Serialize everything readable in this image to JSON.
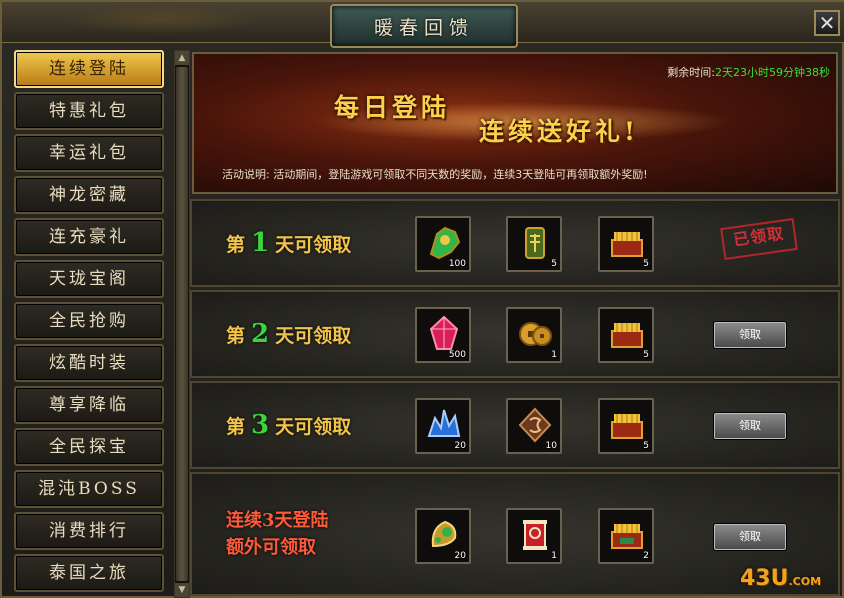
{
  "window": {
    "title": "暖春回馈",
    "close_label": "✕"
  },
  "sidebar": {
    "items": [
      {
        "label": "连续登陆",
        "active": true
      },
      {
        "label": "特惠礼包"
      },
      {
        "label": "幸运礼包"
      },
      {
        "label": "神龙密藏"
      },
      {
        "label": "连充豪礼"
      },
      {
        "label": "天珑宝阁"
      },
      {
        "label": "全民抢购"
      },
      {
        "label": "炫酷时装"
      },
      {
        "label": "尊享降临"
      },
      {
        "label": "全民探宝"
      },
      {
        "label": "混沌BOSS"
      },
      {
        "label": "消费排行"
      },
      {
        "label": "泰国之旅"
      }
    ]
  },
  "banner": {
    "countdown_label": "剩余时间:",
    "countdown_value": "2天23小时59分钟38秒",
    "slogan_line1": "每日登陆",
    "slogan_line2": "连续送好礼!",
    "description": "活动说明: 活动期间，登陆游戏可领取不同天数的奖励，连续3天登陆可再领取额外奖励!"
  },
  "rows": [
    {
      "prefix": "第",
      "day": "1",
      "suffix": "天可领取",
      "status": "已领取",
      "items": [
        {
          "icon": "green-jade-icon",
          "count": "100"
        },
        {
          "icon": "talisman-icon",
          "count": "5"
        },
        {
          "icon": "gold-chest-icon",
          "count": "5"
        }
      ]
    },
    {
      "prefix": "第",
      "day": "2",
      "suffix": "天可领取",
      "button": "领取",
      "items": [
        {
          "icon": "red-crystal-icon",
          "count": "500"
        },
        {
          "icon": "copper-coin-icon",
          "count": "1"
        },
        {
          "icon": "gold-chest-icon",
          "count": "5"
        }
      ]
    },
    {
      "prefix": "第",
      "day": "3",
      "suffix": "天可领取",
      "button": "领取",
      "items": [
        {
          "icon": "blue-crystal-icon",
          "count": "20"
        },
        {
          "icon": "rune-stone-icon",
          "count": "10"
        },
        {
          "icon": "gold-chest-icon",
          "count": "5"
        }
      ]
    },
    {
      "line1": "连续3天登陆",
      "line2": "额外可领取",
      "button": "领取",
      "items": [
        {
          "icon": "jade-pendant-icon",
          "count": "20"
        },
        {
          "icon": "scroll-icon",
          "count": "1"
        },
        {
          "icon": "gold-chest-icon",
          "count": "2"
        }
      ]
    }
  ],
  "watermark": {
    "text": "43U",
    "suffix": ".COM"
  }
}
